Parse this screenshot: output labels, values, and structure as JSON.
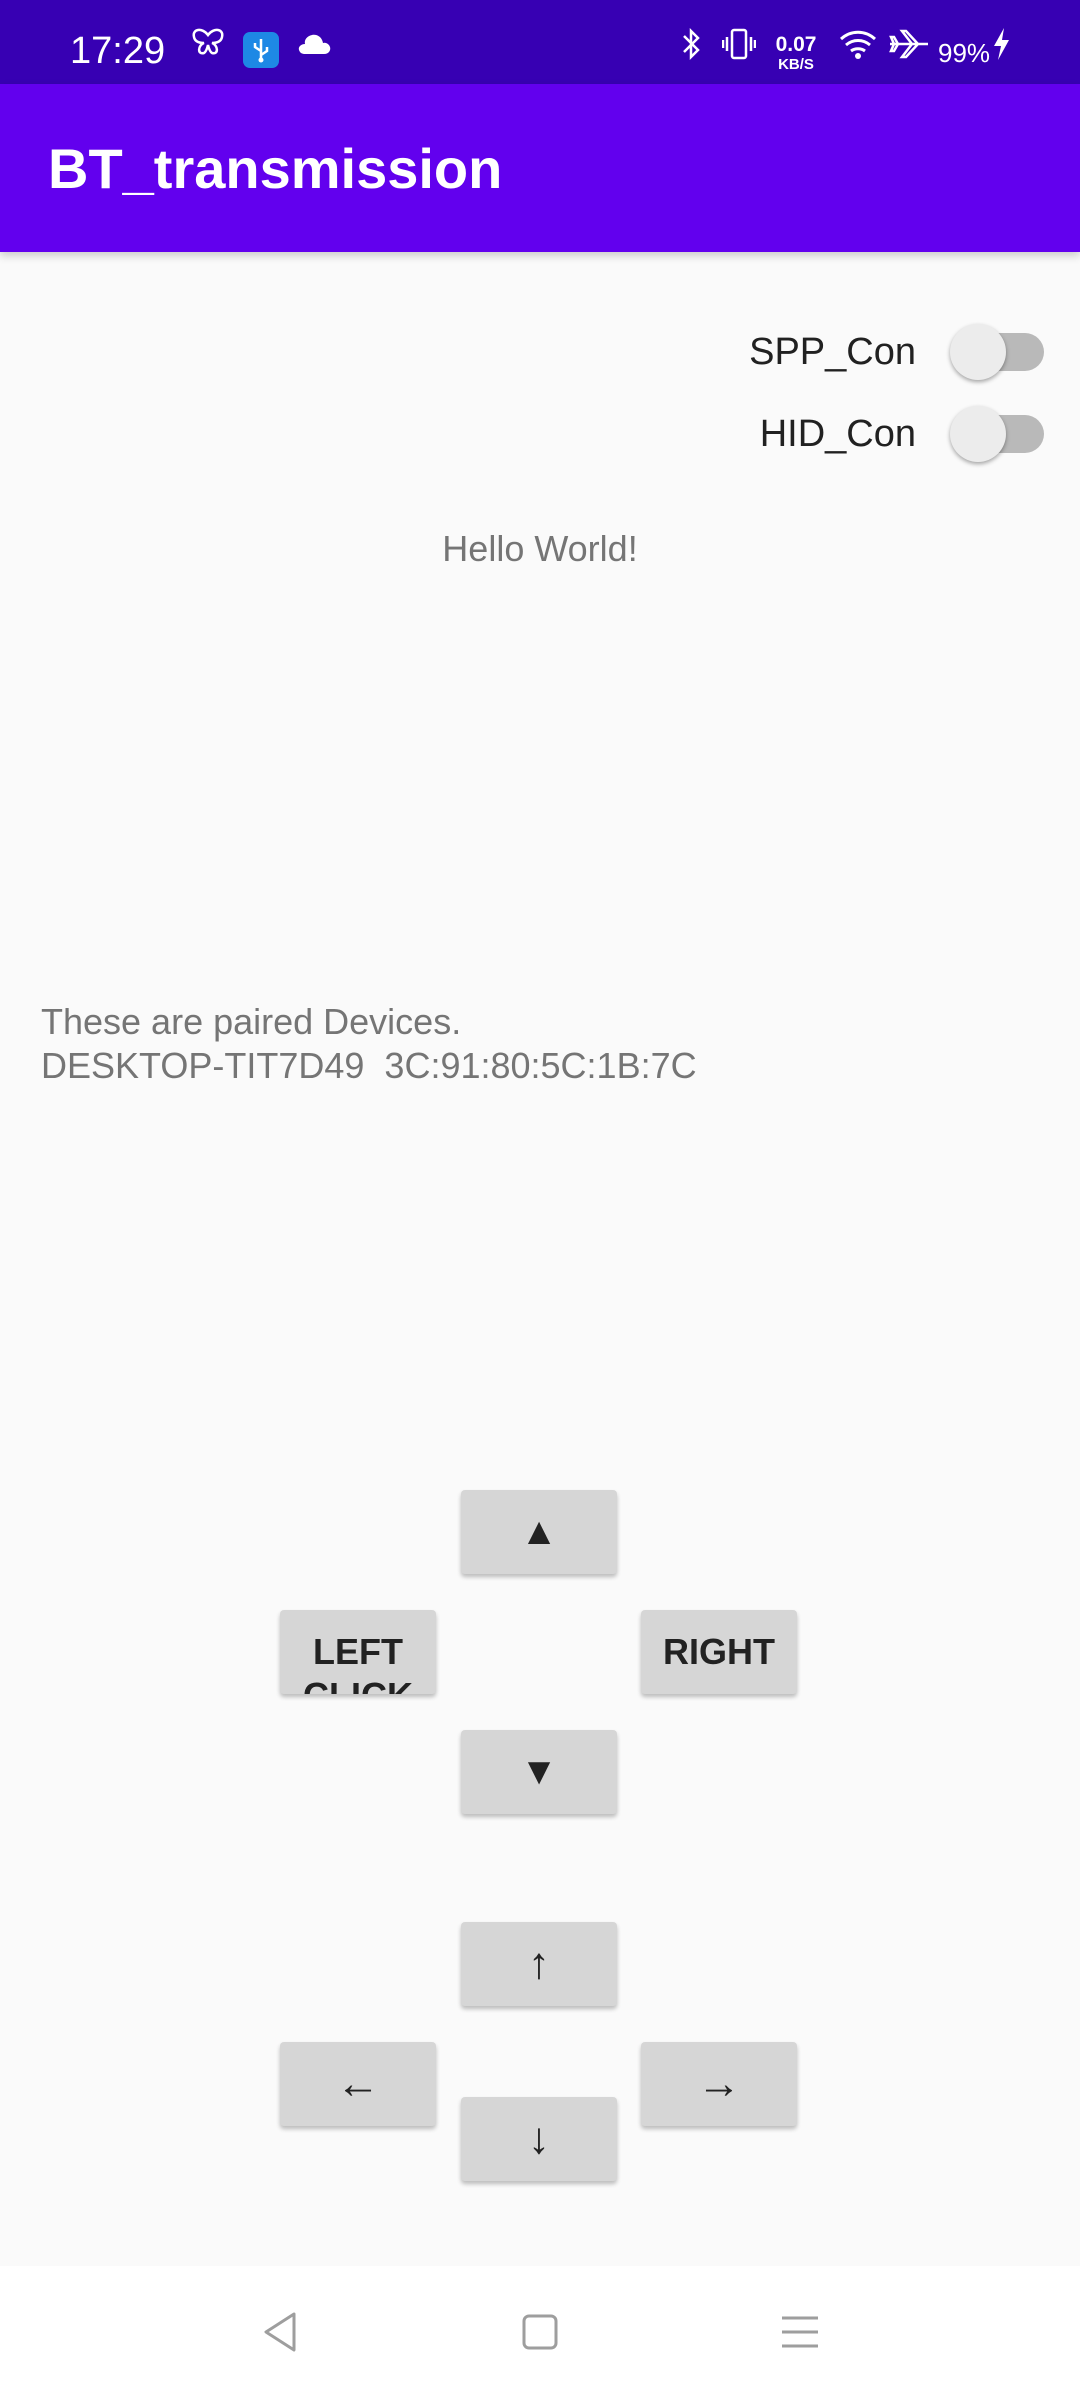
{
  "status_bar": {
    "time": "17:29",
    "net_speed_value": "0.07",
    "net_speed_unit": "KB/S",
    "battery": "99%",
    "icons": [
      "butterfly-icon",
      "usb-icon",
      "cloud-icon",
      "bluetooth-icon",
      "vibrate-icon",
      "wifi-icon",
      "airplane-icon",
      "charging-icon"
    ]
  },
  "app_bar": {
    "title": "BT_transmission"
  },
  "switches": [
    {
      "label": "SPP_Con",
      "on": false
    },
    {
      "label": "HID_Con",
      "on": false
    }
  ],
  "main": {
    "hello_text": "Hello World!",
    "paired_header": "These are paired Devices.",
    "paired_device": "DESKTOP-TIT7D49  3C:91:80:5C:1B:7C"
  },
  "controls": {
    "up_triangle": "▲",
    "left_click": "LEFT CLICK",
    "right_click": "RIGHT",
    "down_triangle": "▼",
    "arrow_up": "↑",
    "arrow_left": "←",
    "arrow_right": "→",
    "arrow_down": "↓"
  },
  "nav_bar": {
    "icons": [
      "back-icon",
      "home-icon",
      "recents-icon"
    ]
  },
  "colors": {
    "status_bar": "#3700b3",
    "app_bar": "#6200ee",
    "button": "#d6d6d6",
    "background": "#fafafa"
  }
}
